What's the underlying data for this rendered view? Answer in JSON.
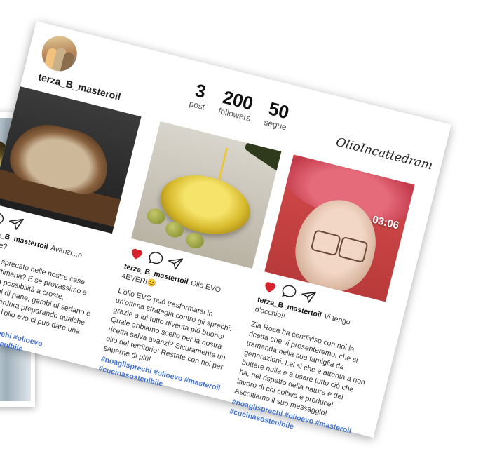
{
  "profile": {
    "username": "terza_B_masteroil",
    "brand": "OlioIncattedram"
  },
  "stats": [
    {
      "value": "3",
      "label": "post"
    },
    {
      "value": "200",
      "label": "followers"
    },
    {
      "value": "50",
      "label": "segue"
    }
  ],
  "posts": [
    {
      "user": "terza_B_mastertoil",
      "title": "Avanzi...o risorse?",
      "body": "Il pane sprecato nelle nostre case ogni settimana? E se provassimo a dare una possibilità a croste, mozziconi di pane, gambi di sedano e foglie di verdura preparando qualche ricetta con l'olio evo ci può dare una mano.",
      "hashtags": "#noaglisprechi #olioevo #cucinasostenibile",
      "liked": false
    },
    {
      "user": "terza_B_mastertoil",
      "title": "Olio EVO 4EVER!😊",
      "body": "L'olio EVO può trasformarsi in un'ottima strategia contro gli sprechi: grazie a lui tutto diventa più buono! Quale abbiamo scelto per la nostra ricetta salva avanzi? Sicuramente un olio del territorio! Restate con noi per saperne di più!",
      "hashtags": "#noaglisprechi #olioevo #masteroil #cucinasostenibile",
      "liked": true
    },
    {
      "user": "terza_B_mastertoil",
      "title": "Vi tengo d'occhio!!",
      "body": "Zia Rosa ha condiviso con noi la ricetta che vi presenteremo, che si tramanda nella sua famiglia da generazioni. Lei si che è attenta a non buttare nulla e a usare tutto ciò che ha, nel rispetto della natura e del lavoro di chi coltiva e produce! Ascoltiamo il suo messaggio!",
      "hashtags": "#noaglisprechi #olioevo #masteroil #cucinasostenibile",
      "liked": true,
      "timer": "03:06"
    }
  ],
  "colors": {
    "heart": "#d6222c",
    "hashtag": "#3f6fd1"
  }
}
